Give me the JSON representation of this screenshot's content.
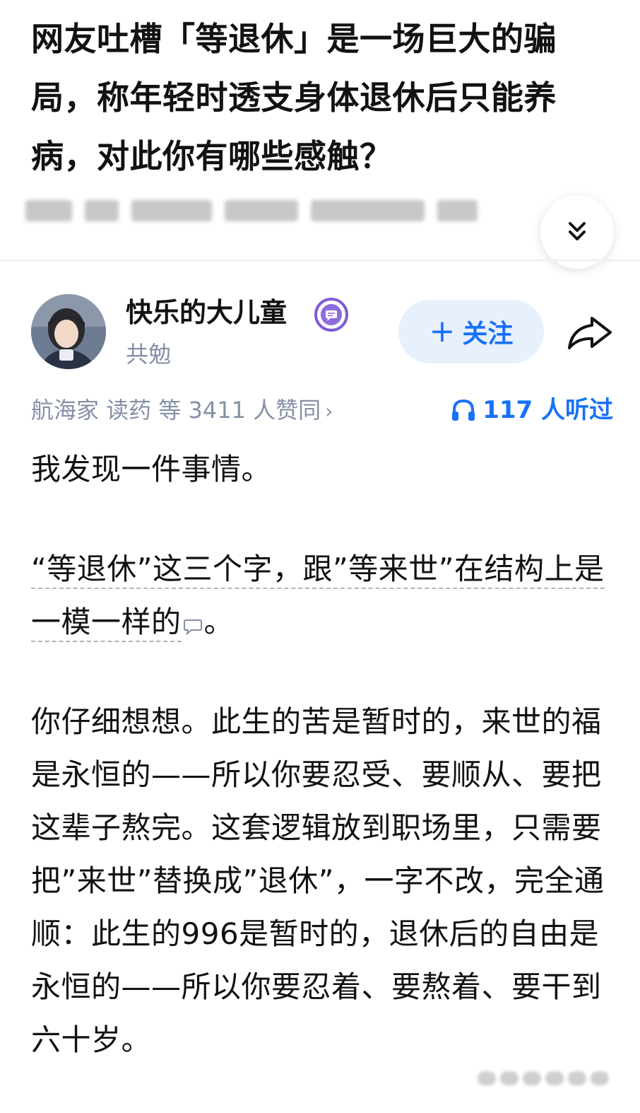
{
  "question": {
    "title": "网友吐槽「等退休」是一场巨大的骗局，称年轻时透支身体退休后只能养病，对此你有哪些感触？"
  },
  "author": {
    "name": "快乐的大儿童",
    "bio": "共勉",
    "follow_label": "关注",
    "follow_plus": "+"
  },
  "stats": {
    "endorse_text": "航海家 读药 等 3411 人赞同",
    "endorse_chevron": "›",
    "listened_text": "117 人听过"
  },
  "answer": {
    "p1": "我发现一件事情。",
    "p2_annotated": "“等退休”这三个字，跟”等来世”在结构上是一模一样的",
    "p2_tail": "。",
    "p3": "你仔细想想。此生的苦是暂时的，来世的福是永恒的——所以你要忍受、要顺从、要把这辈子熬完。这套逻辑放到职场里，只需要把”来世”替换成”退休”，一字不改，完全通顺：此生的996是暂时的，退休后的自由是永恒的——所以你要忍着、要熬着、要干到六十岁。"
  },
  "icons": {
    "expand": "double-chevron-down-icon",
    "badge": "message-badge-icon",
    "share": "share-arrow-icon",
    "listen": "headphone-icon",
    "comment": "comment-bubble-icon"
  },
  "colors": {
    "accent": "#1772f6",
    "muted": "#8590a6",
    "text": "#121212",
    "badge": "#7e5bd6"
  }
}
